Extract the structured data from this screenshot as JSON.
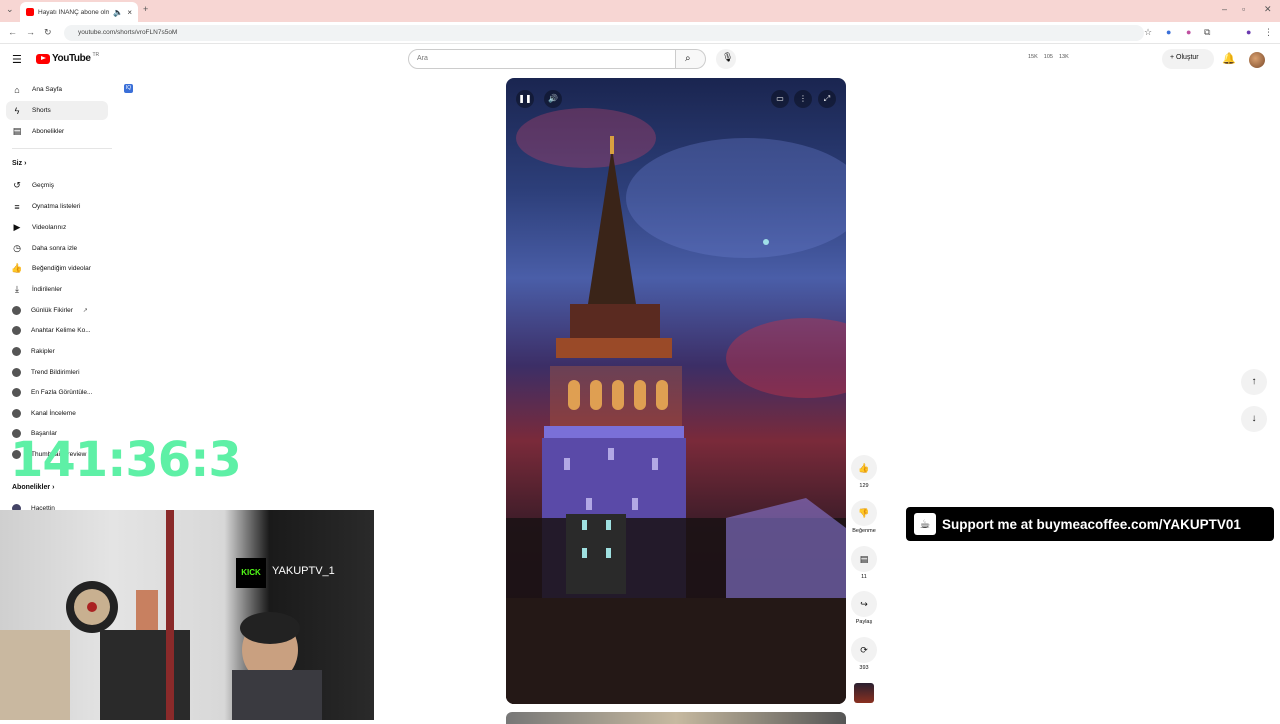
{
  "browser": {
    "tab_title": "Hayatı İNANÇ abone olma...",
    "tab_close": "×",
    "new_tab": "+",
    "url": "youtube.com/shorts/vroFLN7s5oM"
  },
  "header": {
    "logo_text": "YouTube",
    "logo_region": "TR",
    "search_placeholder": "Ara",
    "stats": [
      "15K",
      "105",
      "13K"
    ],
    "create_label": "Oluştur"
  },
  "sidebar": {
    "top_items": [
      {
        "label": "Ana Sayfa",
        "icon": "home-icon"
      },
      {
        "label": "Shorts",
        "icon": "shorts-icon"
      },
      {
        "label": "Abonelikler",
        "icon": "subscriptions-icon"
      }
    ],
    "you_section": "Siz",
    "you_items": [
      {
        "label": "Geçmiş",
        "icon": "history-icon"
      },
      {
        "label": "Oynatma listeleri",
        "icon": "playlist-icon"
      },
      {
        "label": "Videolarınız",
        "icon": "your-videos-icon"
      },
      {
        "label": "Daha sonra izle",
        "icon": "watch-later-icon"
      },
      {
        "label": "Beğendiğim videolar",
        "icon": "liked-icon"
      },
      {
        "label": "İndirilenler",
        "icon": "download-icon"
      }
    ],
    "ext_items": [
      "Günlük Fikirler",
      "Anahtar Kelime Ko...",
      "Rakipler",
      "Trend Bildirimleri",
      "En Fazla Görüntüle...",
      "Kanal İnceleme",
      "Başarılar",
      "Thumbnail Preview"
    ],
    "subs_section": "Abonelikler",
    "subs_first": "Hacettin"
  },
  "extension_badge": "IQ",
  "actions": {
    "likes": "129",
    "dislike_label": "Beğenme",
    "comments": "11",
    "share_label": "Paylaş",
    "remix": "393"
  },
  "overlay": {
    "timer": "141:36:3",
    "kick_logo": "KICK",
    "kick_name": "YAKUPTV_1",
    "support_prefix": "Support me at ",
    "support_url": "buymeacoffee.com/YAKUPTV01"
  },
  "colors": {
    "accent": "#ff0000",
    "timer": "#5ef0a6",
    "kick": "#53fc18"
  }
}
